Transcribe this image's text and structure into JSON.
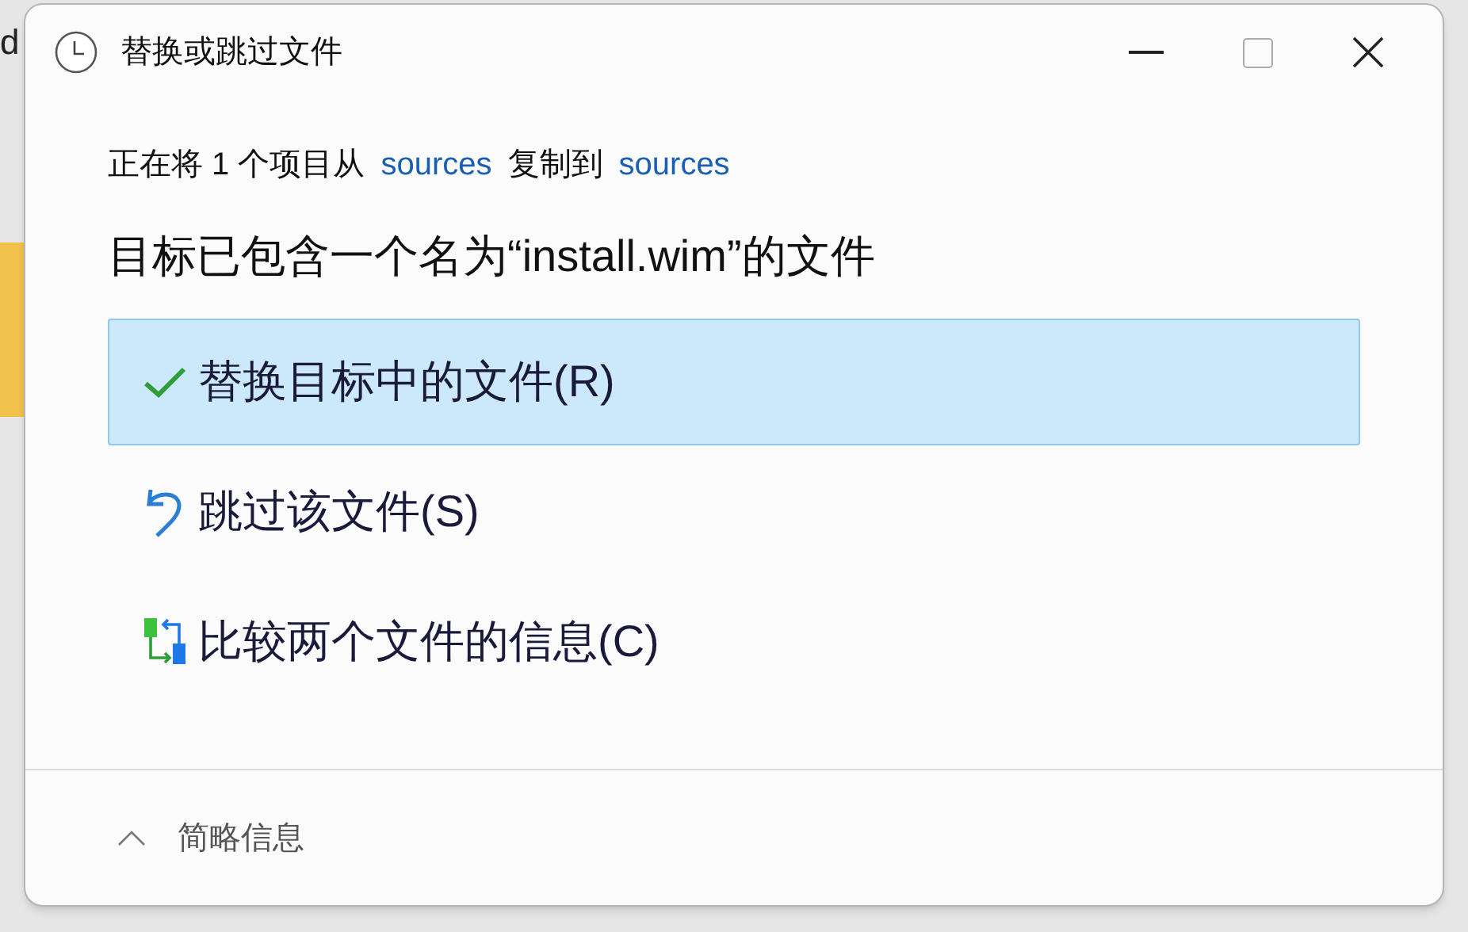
{
  "background": {
    "edge_text": "d"
  },
  "window": {
    "title": "替换或跳过文件"
  },
  "summary": [
    {
      "kind": "text",
      "text": "正在将 1 个项目从"
    },
    {
      "kind": "link",
      "text": "sources"
    },
    {
      "kind": "text",
      "text": "复制到"
    },
    {
      "kind": "link",
      "text": "sources"
    }
  ],
  "heading": "目标已包含一个名为“install.wim”的文件",
  "options": [
    {
      "kind": "replace",
      "label": "替换目标中的文件(R)",
      "selected": true
    },
    {
      "kind": "skip",
      "label": "跳过该文件(S)",
      "selected": false
    },
    {
      "kind": "compare",
      "label": "比较两个文件的信息(C)",
      "selected": false
    }
  ],
  "footer": {
    "toggle": "简略信息"
  }
}
